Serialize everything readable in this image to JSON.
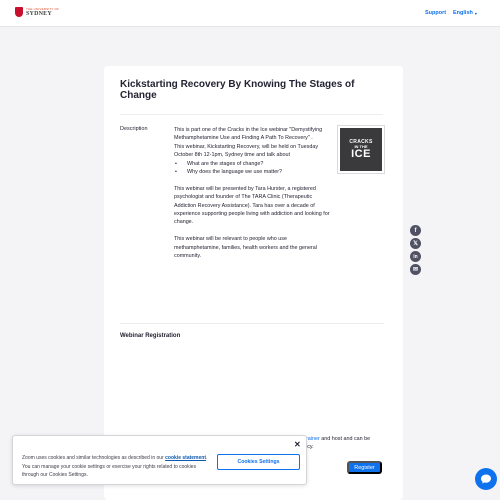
{
  "header": {
    "logo_line1": "THE UNIVERSITY OF",
    "logo_line2": "SYDNEY",
    "support_label": "Support",
    "language_label": "English"
  },
  "webinar": {
    "title": "Kickstarting Recovery By Knowing The Stages of Change",
    "description_label": "Description",
    "description": {
      "p1": "This is part one of the Cracks in the Ice webinar \"Demystifying Methamphetamine Use and Finding A Path To Recovery\" .",
      "p2": "This webinar, Kickstarting Recovery, will be held on Tuesday October 8th 12-1pm, Sydney time and talk about",
      "bullets": [
        "What are the stages of change?",
        "Why does the language we use matter?"
      ],
      "p3": "This webinar will be presented by Tara Hurster, a registered psychologist and founder of The TARA Clinic (Therapeutic Addiction Recovery Assistance). Tara has over a decade of experience supporting people living with addiction and looking for change.",
      "p4": "This webinar will be relevant to people who use methamphetamine, families, health workers and the general community."
    },
    "thumbnail": {
      "line1": "CRACKS",
      "line2": "IN THE",
      "line3": "ICE"
    },
    "registration_heading": "Webinar Registration",
    "registration_fragment": {
      "link_text": "rainer",
      "text1": " and host and can be",
      "text2": "icy."
    },
    "register_label": "Register"
  },
  "cookie_banner": {
    "text_before": "Zoom uses cookies and similar technologies as described in our ",
    "link_text": "cookie statement",
    "text_after": ". You can manage your cookie settings or exercise your rights related to cookies through our Cookies Settings.",
    "settings_button": "Cookies Settings",
    "close_symbol": "✕"
  },
  "share": {
    "facebook_glyph": "f",
    "x_glyph": "𝕏",
    "linkedin_glyph": "in",
    "email_glyph": "✉"
  },
  "colors": {
    "accent": "#0e72ed",
    "share_icon_bg": "#515164"
  }
}
